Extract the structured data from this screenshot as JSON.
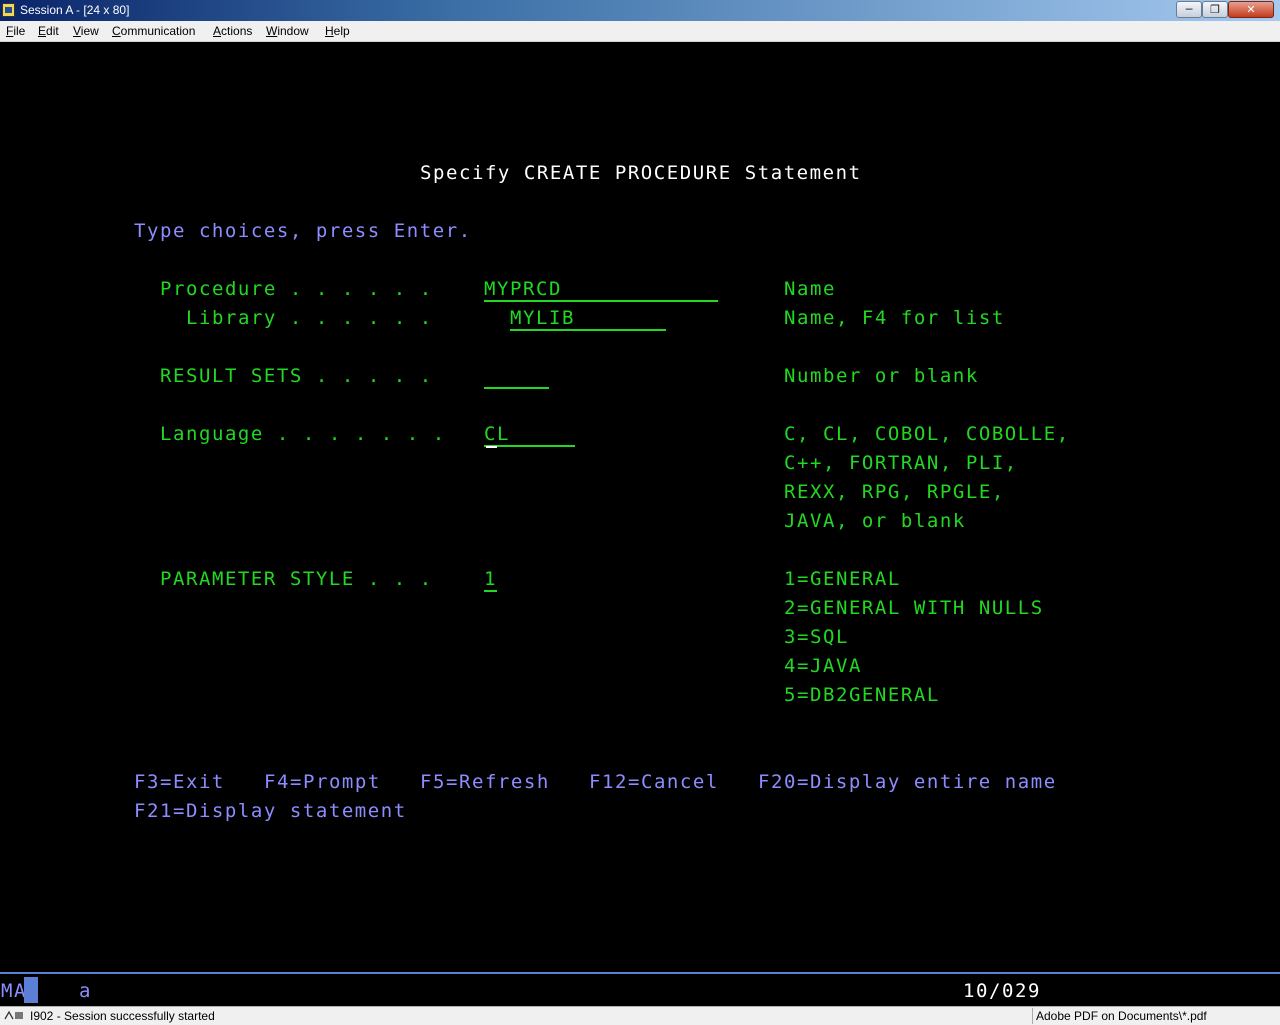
{
  "window": {
    "title": "Session A - [24 x 80]"
  },
  "menu": [
    "File",
    "Edit",
    "View",
    "Communication",
    "Actions",
    "Window",
    "Help"
  ],
  "screen": {
    "heading": "Specify CREATE PROCEDURE Statement",
    "instruction": "Type choices, press Enter.",
    "procedure": {
      "label": "Procedure . . . . . .",
      "value": "MYPRCD",
      "hint": "Name"
    },
    "library": {
      "label": "Library . . . . . .",
      "value": "MYLIB",
      "hint": "Name, F4 for list"
    },
    "result_sets": {
      "label": "RESULT SETS . . . . .",
      "value": "",
      "hint": "Number or blank"
    },
    "language": {
      "label": "Language . . . . . . .",
      "value": "CL",
      "hints": [
        "C, CL, COBOL, COBOLLE,",
        "C++, FORTRAN, PLI,",
        "REXX, RPG, RPGLE,",
        "JAVA, or blank"
      ]
    },
    "parameter_style": {
      "label": "PARAMETER STYLE . . .",
      "value": "1",
      "options": [
        "1=GENERAL",
        "2=GENERAL WITH NULLS",
        "3=SQL",
        "4=JAVA",
        "5=DB2GENERAL"
      ]
    },
    "function_keys": {
      "line1": [
        "F3=Exit",
        "F4=Prompt",
        "F5=Refresh",
        "F12=Cancel",
        "F20=Display entire name"
      ],
      "line2": [
        "F21=Display statement"
      ]
    }
  },
  "oia": {
    "mode": "MA",
    "indicator": "a",
    "cursor_position": "10/029"
  },
  "status": {
    "message": "I902 - Session successfully started",
    "printer": "Adobe PDF on Documents\\*.pdf"
  }
}
